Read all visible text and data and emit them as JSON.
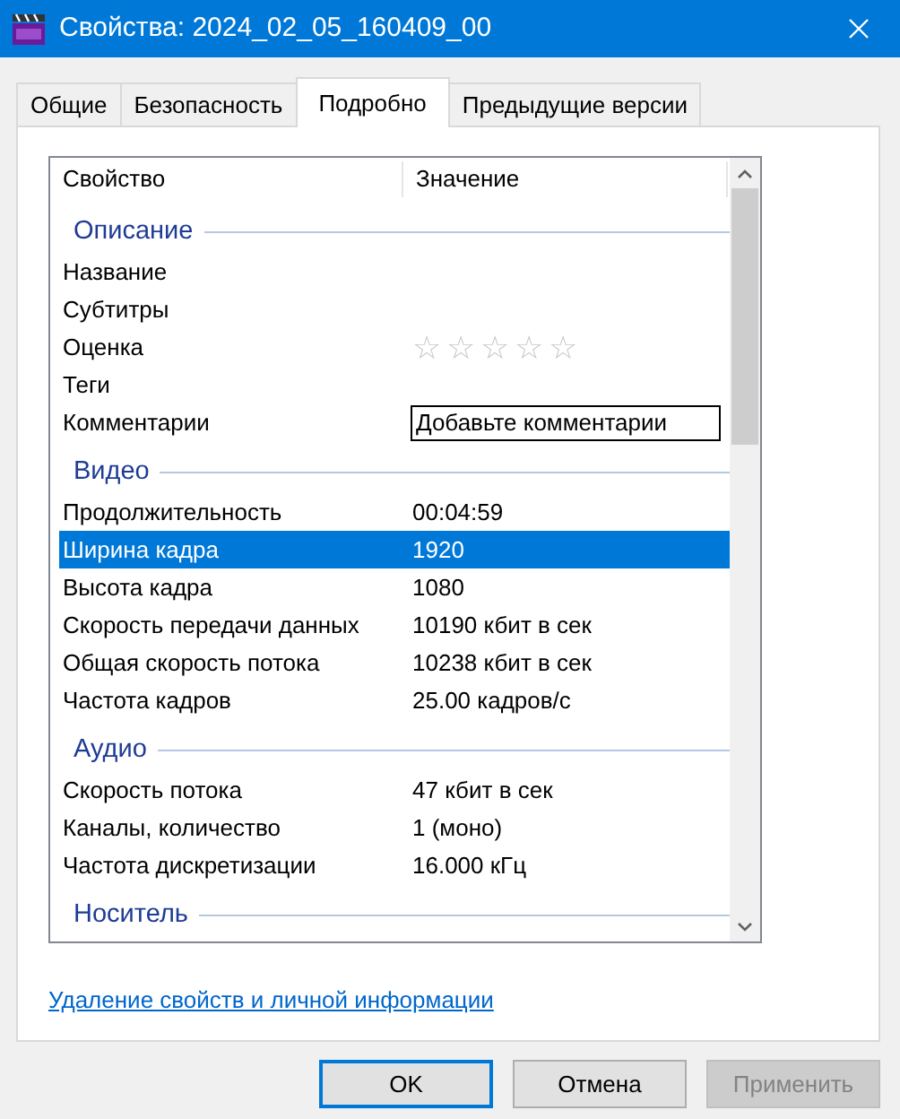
{
  "window": {
    "title": "Свойства: 2024_02_05_160409_00"
  },
  "tabs": [
    {
      "label": "Общие",
      "selected": false
    },
    {
      "label": "Безопасность",
      "selected": false
    },
    {
      "label": "Подробно",
      "selected": true
    },
    {
      "label": "Предыдущие версии",
      "selected": false
    }
  ],
  "list": {
    "columns": [
      "Свойство",
      "Значение"
    ],
    "sections": [
      {
        "title": "Описание",
        "rows": [
          {
            "kind": "text",
            "name": "Название",
            "selected": false
          },
          {
            "kind": "text",
            "name": "Субтитры",
            "selected": false
          },
          {
            "kind": "rating",
            "name": "Оценка",
            "stars": 0,
            "selected": false
          },
          {
            "kind": "text",
            "name": "Теги",
            "selected": false
          },
          {
            "kind": "input",
            "name": "Комментарии",
            "value": "Добавьте комментарии",
            "selected": false
          }
        ]
      },
      {
        "title": "Видео",
        "rows": [
          {
            "kind": "text",
            "name": "Продолжительность",
            "value": "00:04:59",
            "selected": false
          },
          {
            "kind": "text",
            "name": "Ширина кадра",
            "value": "1920",
            "selected": true
          },
          {
            "kind": "text",
            "name": "Высота кадра",
            "value": "1080",
            "selected": false
          },
          {
            "kind": "text",
            "name": "Скорость передачи данных",
            "value": "10190 кбит в сек",
            "selected": false
          },
          {
            "kind": "text",
            "name": "Общая скорость потока",
            "value": "10238 кбит в сек",
            "selected": false
          },
          {
            "kind": "text",
            "name": "Частота кадров",
            "value": "25.00 кадров/с",
            "selected": false
          }
        ]
      },
      {
        "title": "Аудио",
        "rows": [
          {
            "kind": "text",
            "name": "Скорость потока",
            "value": "47 кбит в сек",
            "selected": false
          },
          {
            "kind": "text",
            "name": "Каналы, количество",
            "value": "1 (моно)",
            "selected": false
          },
          {
            "kind": "text",
            "name": "Частота дискретизации",
            "value": "16.000 кГц",
            "selected": false
          }
        ]
      },
      {
        "title": "Носитель"
      }
    ]
  },
  "link": "Удаление свойств и личной информации",
  "buttons": [
    {
      "label": "OK",
      "default": true,
      "disabled": false
    },
    {
      "label": "Отмена",
      "default": false,
      "disabled": false
    },
    {
      "label": "Применить",
      "default": false,
      "disabled": true
    }
  ]
}
